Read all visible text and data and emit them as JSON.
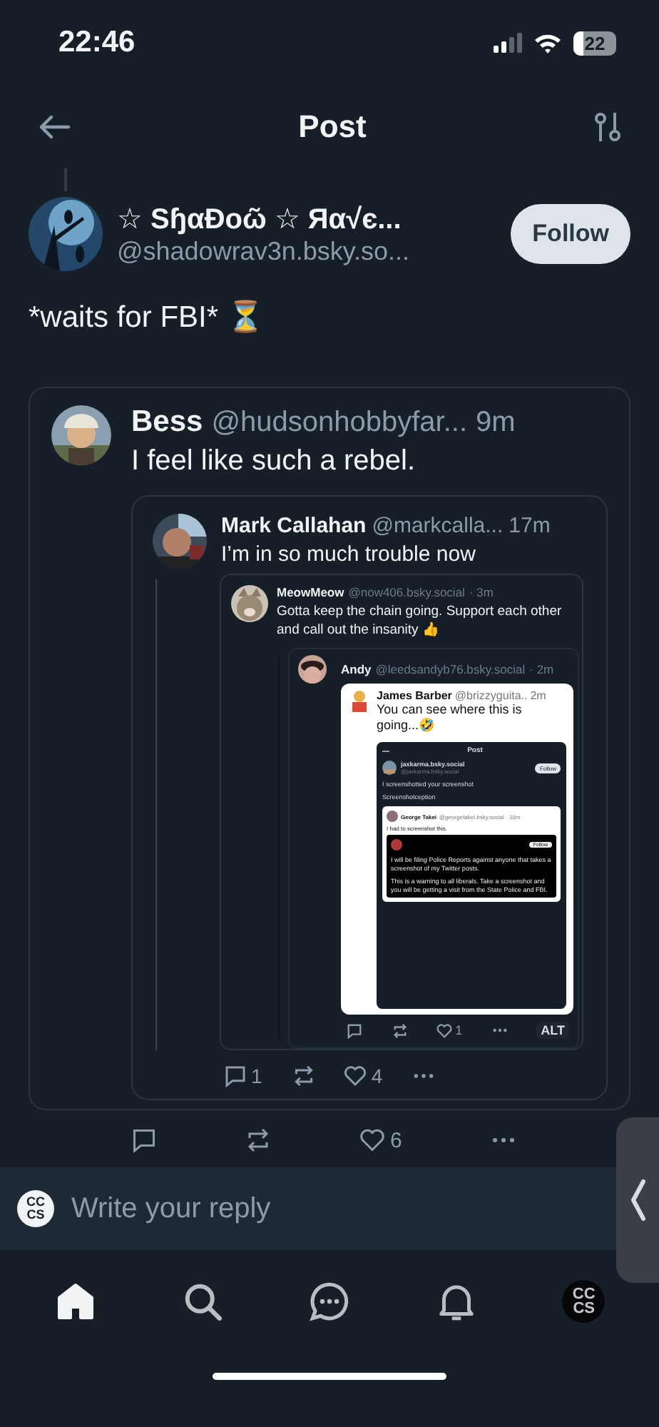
{
  "status_bar": {
    "time": "22:46",
    "battery": "22"
  },
  "header": {
    "title": "Post"
  },
  "post": {
    "author": {
      "name": "☆ SɧαÐoῶ ☆ Яα√є...",
      "handle": "@shadowrav3n.bsky.so..."
    },
    "follow_label": "Follow",
    "text": "*waits for FBI* ⏳",
    "quote": {
      "name": "Bess",
      "handle": "@hudsonhobbyfar...",
      "time": "9m",
      "text": "I feel like such a rebel.",
      "quote": {
        "name": "Mark Callahan",
        "handle": "@markcalla...",
        "time": "17m",
        "text": "I’m in so much trouble now",
        "quote": {
          "name": "MeowMeow",
          "handle": "@now406.bsky.social",
          "time": "· 3m",
          "text": "Gotta keep the chain going. Support each other and call out the insanity 👍",
          "reply": {
            "name": "Andy",
            "handle": "@leedsandyb76.bsky.social",
            "time": "· 2m",
            "image": {
              "name": "James Barber",
              "handle": "@brizzyguita..",
              "time": "2m",
              "text": "You can see where this is going...🤣",
              "screenshot": {
                "title": "Post",
                "account": "jaxkarma.bsky.social",
                "account_handle": "@jaxkarma.bsky.social",
                "follow_label": "Follow",
                "text": "I screenshotted your screenshot",
                "text_2": "Screenshotception",
                "quote": {
                  "name": "George Takei",
                  "handle": "@georgetakei.bsky.social · 16m",
                  "text": "I had to screenshot this.",
                  "tweet": {
                    "follow_label": "Follow",
                    "paragraphs": [
                      "I will be filing Police Reports against anyone that takes a screenshot of my Twitter posts.",
                      "This is a warning to all liberals. Take a screenshot and you will be getting a visit from the State Police and FBI."
                    ]
                  }
                }
              }
            },
            "alt": "ALT",
            "actions": [
              {
                "kind": "reply"
              },
              {
                "kind": "repost"
              },
              {
                "kind": "like",
                "count": "1"
              },
              {
                "kind": "more"
              }
            ]
          }
        },
        "actions": [
          {
            "kind": "reply",
            "count": "1"
          },
          {
            "kind": "repost"
          },
          {
            "kind": "like",
            "count": "4"
          },
          {
            "kind": "more"
          }
        ]
      }
    },
    "actions": [
      {
        "kind": "reply"
      },
      {
        "kind": "repost"
      },
      {
        "kind": "like",
        "count": "6"
      },
      {
        "kind": "more"
      }
    ]
  },
  "composer": {
    "placeholder": "Write your reply",
    "avatar": "CCCS"
  },
  "tab_bar": [
    {
      "kind": "home",
      "selected": true
    },
    {
      "kind": "search",
      "selected": false
    },
    {
      "kind": "chat",
      "selected": false
    },
    {
      "kind": "notifications",
      "selected": false
    },
    {
      "kind": "profile",
      "label": "CCCS",
      "selected": false
    }
  ]
}
